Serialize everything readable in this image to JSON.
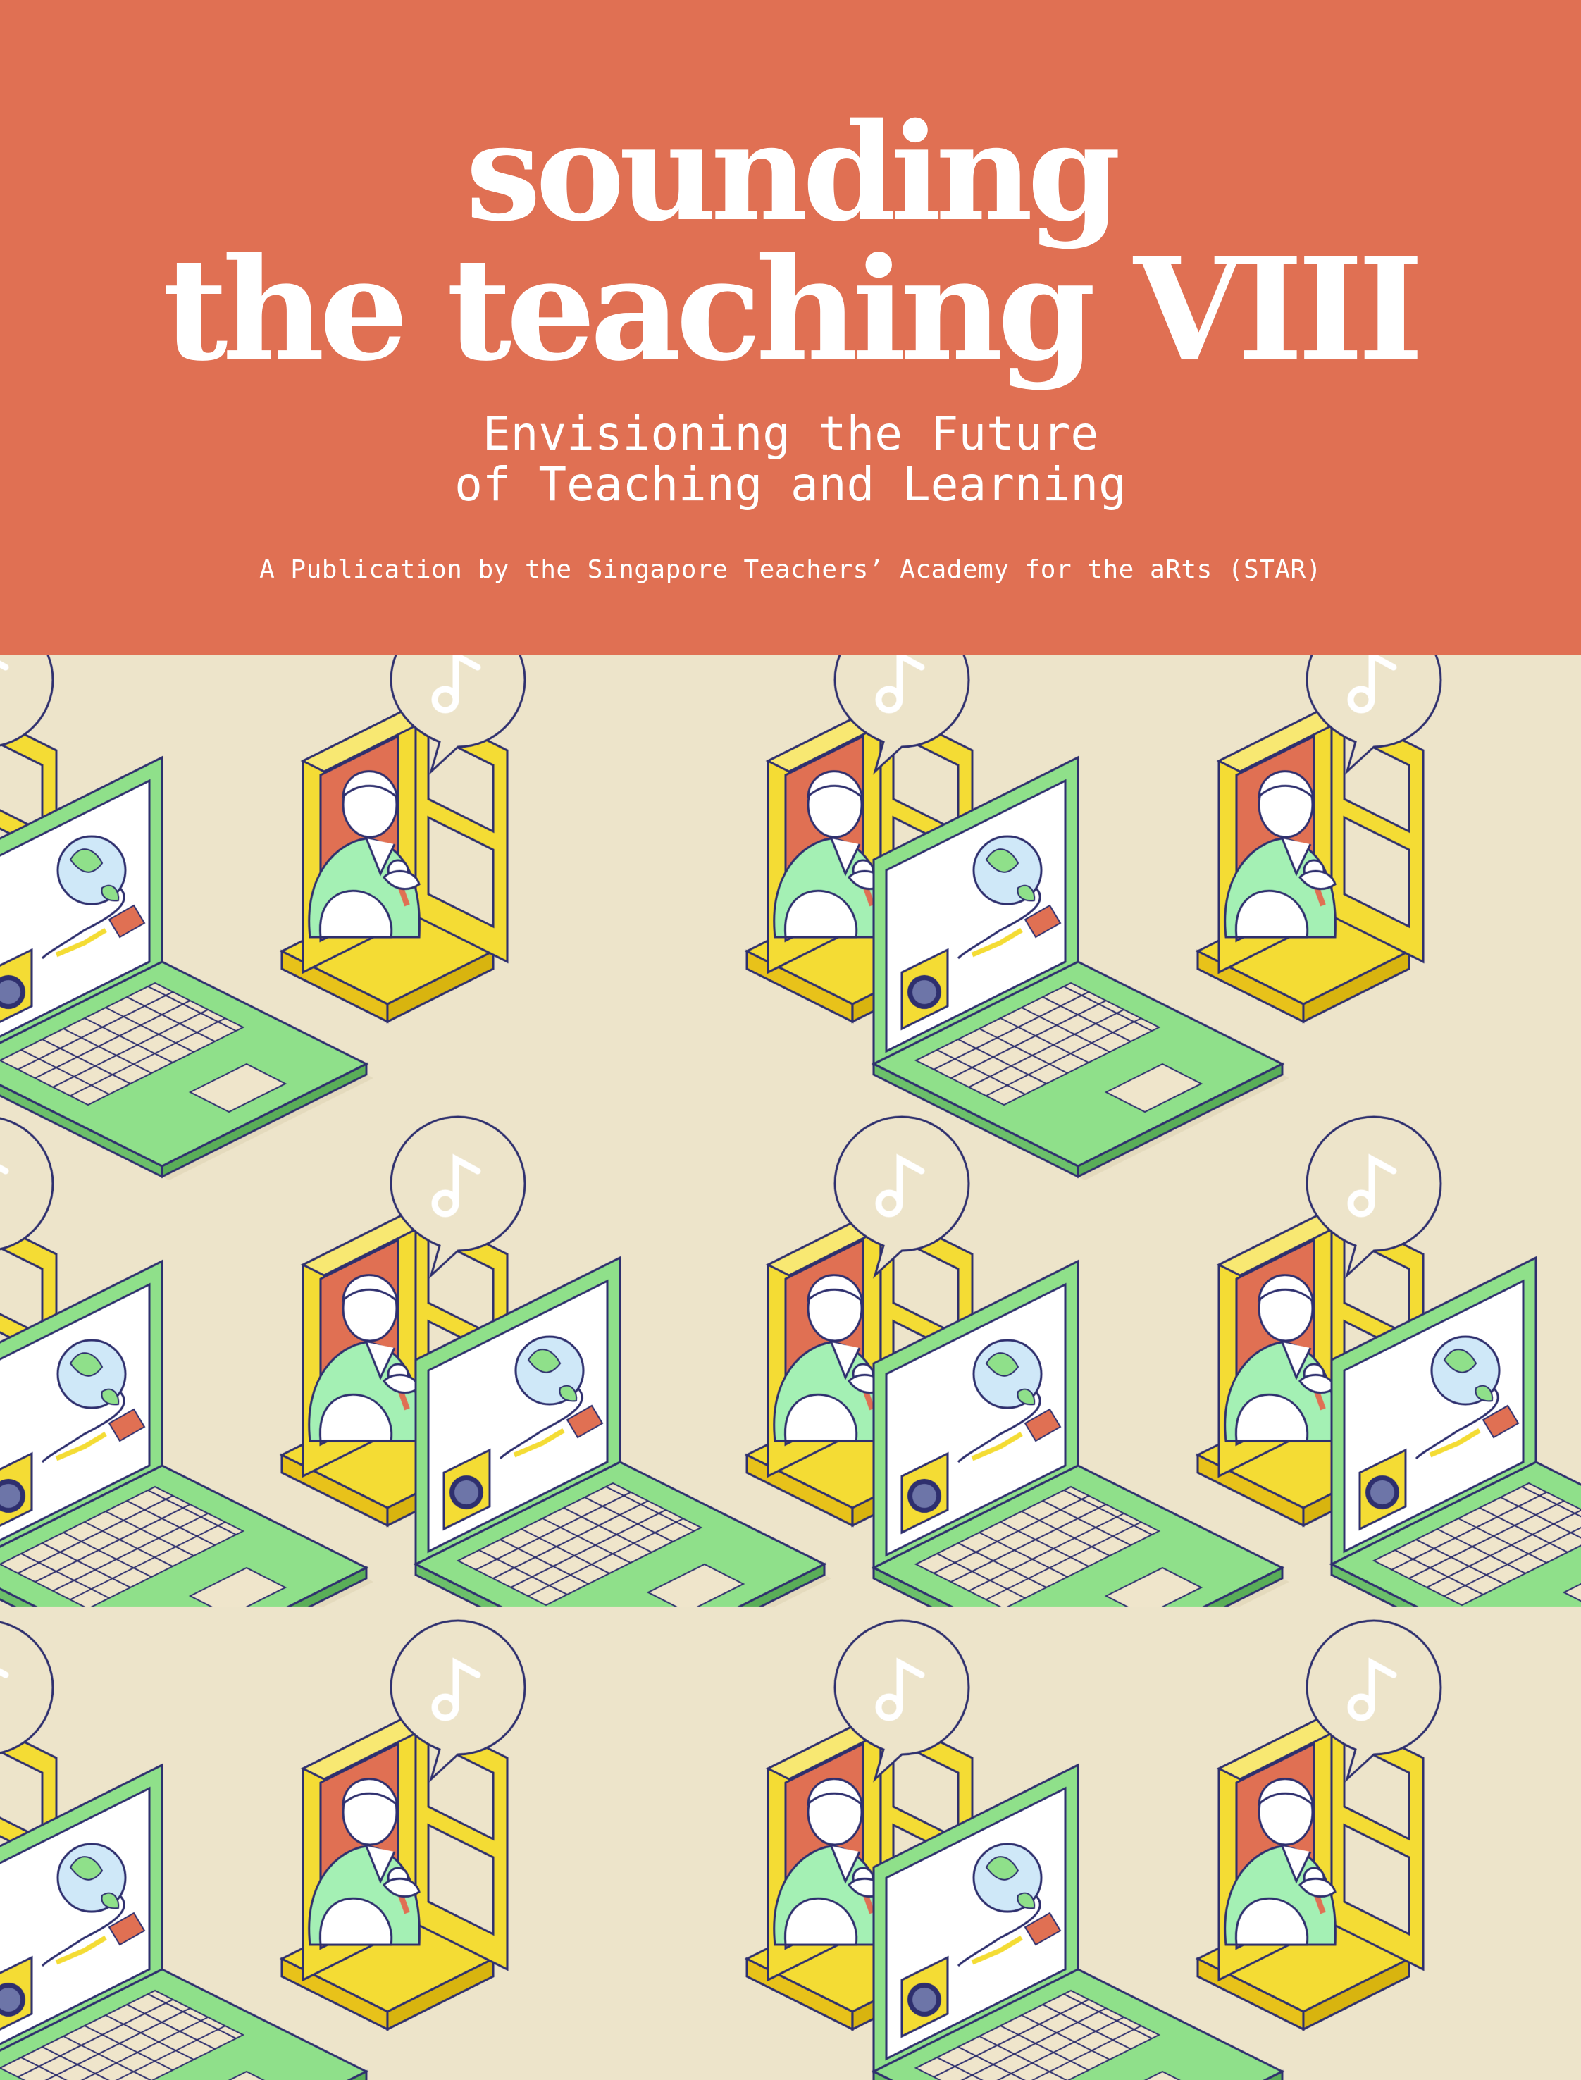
{
  "cover": {
    "title_line1": "sounding",
    "title_line2": "the teaching VIII",
    "subtitle_line1": "Envisioning the Future",
    "subtitle_line2": "of Teaching and Learning",
    "publisher": "A Publication by the Singapore Teachers’ Academy for the aRts (STAR)"
  },
  "illustration": {
    "motifs": [
      "window-frame",
      "laptop",
      "speech-bubble",
      "music-note-icon",
      "globe-icon",
      "speaker-icon",
      "person-with-microphone"
    ]
  },
  "colors": {
    "header_bg": "#e07053",
    "pattern_bg": "#ede4ca",
    "yellow": "#f4dc34",
    "green": "#8fe08a",
    "light_green": "#a4f0b4",
    "outline": "#2e2f6e",
    "white": "#ffffff"
  }
}
